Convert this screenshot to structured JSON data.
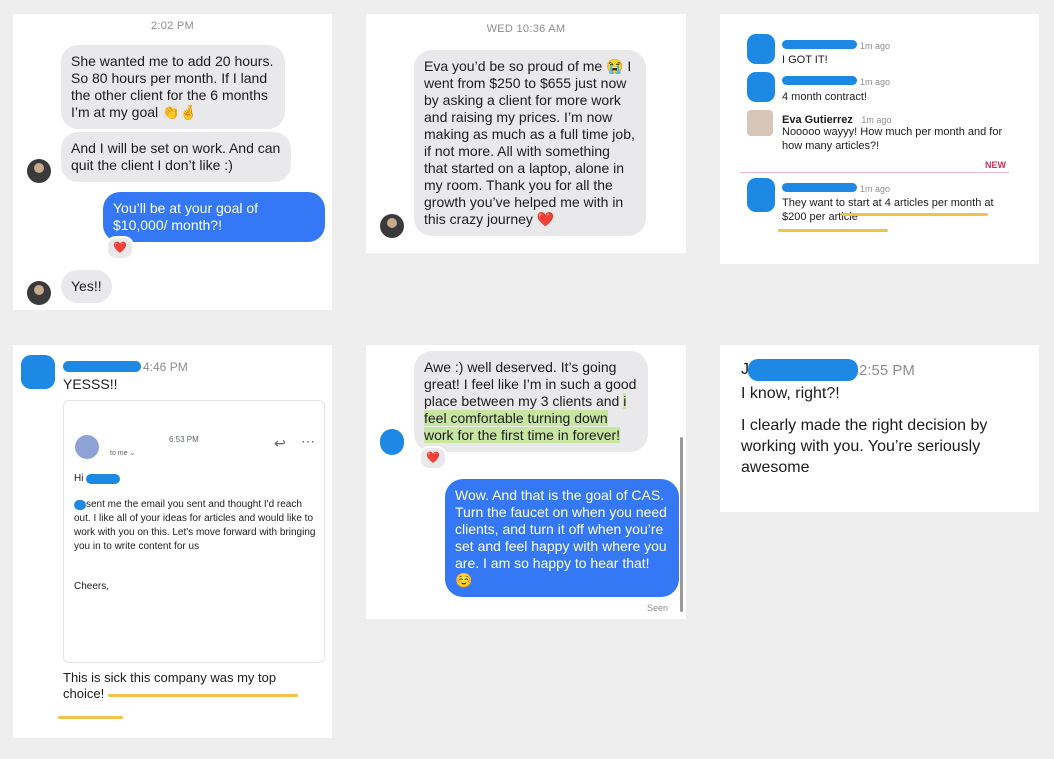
{
  "card1": {
    "time": "2:02 PM",
    "msg1": "She wanted me to add 20 hours. So 80 hours per month. If I land the other client for the 6 months I’m at my goal 👏🤞",
    "msg2": "And I will be set on work. And can quit the client I don’t like :)",
    "msg3": "You’ll be at your goal of $10,000/ month?!",
    "msg3_reaction": "❤️",
    "msg4": "Yes!!"
  },
  "card2": {
    "time": "WED 10:36 AM",
    "msg": "Eva you’d be so proud of me 😭 I went from $250 to $655 just now by asking a client for more work and raising my prices. I’m now making as much as a full time job, if not more. All with something that started on a laptop, alone in my room. Thank you for all the growth you’ve helped me with in this crazy journey ❤️"
  },
  "card3": {
    "messages": [
      {
        "time": "1m ago",
        "text": "I GOT IT!"
      },
      {
        "time": "1m ago",
        "text": "4 month contract!"
      },
      {
        "name": "Eva Gutierrez",
        "time": "1m ago",
        "text": "Nooooo wayyy! How much per month and for how many articles?!"
      },
      {
        "time": "1m ago",
        "text": "They want to start at 4 articles per month at $200 per article"
      }
    ],
    "new_label": "NEW"
  },
  "card4": {
    "time": "4:46 PM",
    "msg": "YESSS!!",
    "email": {
      "time": "6:53 PM",
      "to": "to me ⌄",
      "greeting": "Hi",
      "body": "sent me the email you sent and thought I'd reach out. I like all of your ideas for articles and would like to work with you on this. Let's move forward with bringing you in to write content for us",
      "signoff": "Cheers,"
    },
    "caption": "This is sick this company was my top choice!"
  },
  "card5": {
    "msg1_a": "Awe :) well deserved. It’s going great! I feel like I’m in such a good place between my 3 clients and ",
    "msg1_hl": "i feel comfortable turning down work for the first time in forever!",
    "msg1_reaction": "❤️",
    "msg2": "Wow. And that is the goal of CAS. Turn the faucet on when you need clients, and turn it off when you’re set and feel happy with where you are. I am so happy to hear that! ☺️",
    "status": "Seen"
  },
  "card6": {
    "initial": "J",
    "time": "2:55 PM",
    "msg1": "I know, right?!",
    "msg2": "I clearly made the right decision by working with you. You’re seriously awesome"
  }
}
